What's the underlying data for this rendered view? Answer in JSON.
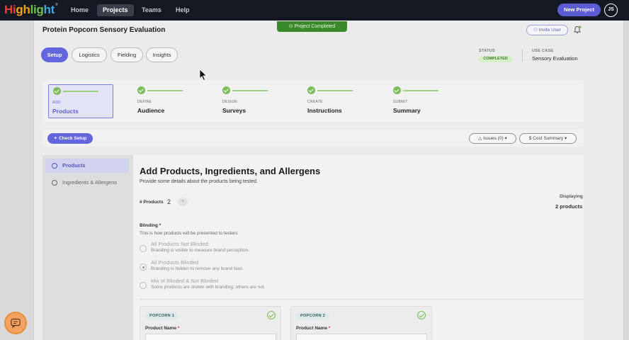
{
  "nav": {
    "logo": [
      "Hi",
      "gh",
      "lig",
      "ht"
    ],
    "logo_mark": "®",
    "links": [
      "Home",
      "Projects",
      "Teams",
      "Help"
    ],
    "active": "Projects",
    "new_project": "New Project",
    "avatar": "JS"
  },
  "project": {
    "title": "Protein Popcorn Sensory Evaluation",
    "completed_pill": "Project Completed",
    "invite_user": "Invite User"
  },
  "tabs": [
    "Setup",
    "Logistics",
    "Fielding",
    "Insights"
  ],
  "status": {
    "status_label": "STATUS",
    "status_value": "COMPLETED",
    "usecase_label": "USE CASE",
    "usecase_value": "Sensory Evaluation"
  },
  "steps": [
    {
      "small": "ADD",
      "big": "Products"
    },
    {
      "small": "DEFINE",
      "big": "Audience"
    },
    {
      "small": "DESIGN",
      "big": "Surveys"
    },
    {
      "small": "CREATE",
      "big": "Instructions"
    },
    {
      "small": "SUBMIT",
      "big": "Summary"
    }
  ],
  "actions": {
    "check_setup": "Check Setup",
    "issues": "Issues (0)",
    "cost_summary": "Cost Summary"
  },
  "sidebar": [
    "Products",
    "Ingredients & Allergens"
  ],
  "main": {
    "title": "Add Products, Ingredients, and Allergens",
    "subtitle": "Provide some details about the products being tested.",
    "num_products_label": "# Products",
    "num_products": "2",
    "displaying_label": "Displaying",
    "displaying_value": "2 products",
    "blinding_label": "Blinding *",
    "blinding_desc": "This is how products will be presented to testers",
    "options": [
      {
        "title": "All Products Not Blinded",
        "desc": "Branding is visible to measure brand perception."
      },
      {
        "title": "All Products Blinded",
        "desc": "Branding is hidden to remove any brand bias."
      },
      {
        "title": "Mix of Blinded & Not Blinded",
        "desc": "Some products are shown with branding; others are not."
      }
    ],
    "products": [
      {
        "tag": "POPCORN 1",
        "field": "Product Name",
        "req": "*"
      },
      {
        "tag": "POPCORN 2",
        "field": "Product Name",
        "req": "*"
      }
    ]
  },
  "colors": {
    "accent": "#6366dc",
    "nav_bg": "#141823",
    "success": "#7dbb5b"
  }
}
